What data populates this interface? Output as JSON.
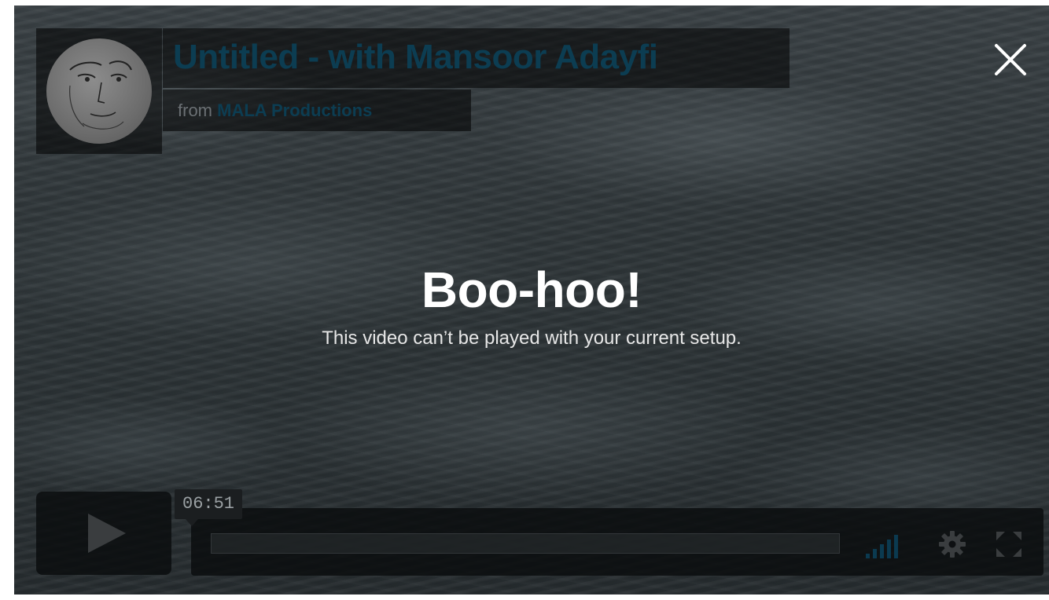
{
  "video": {
    "title": "Untitled - with Mansoor Adayfi",
    "byline_prefix": "from",
    "owner": "MALA Productions"
  },
  "message": {
    "title": "Boo-hoo!",
    "body": "This video can’t be played with your current setup."
  },
  "controls": {
    "duration": "06:51",
    "progress_fraction": 0
  },
  "icons": {
    "close": "close-icon",
    "play": "play-icon",
    "volume": "volume-icon",
    "settings": "gear-icon",
    "fullscreen": "fullscreen-icon"
  },
  "colors": {
    "title_text": "#0c3d52",
    "owner_text": "#0c3d52",
    "volume_bars": "#0b3a50"
  }
}
